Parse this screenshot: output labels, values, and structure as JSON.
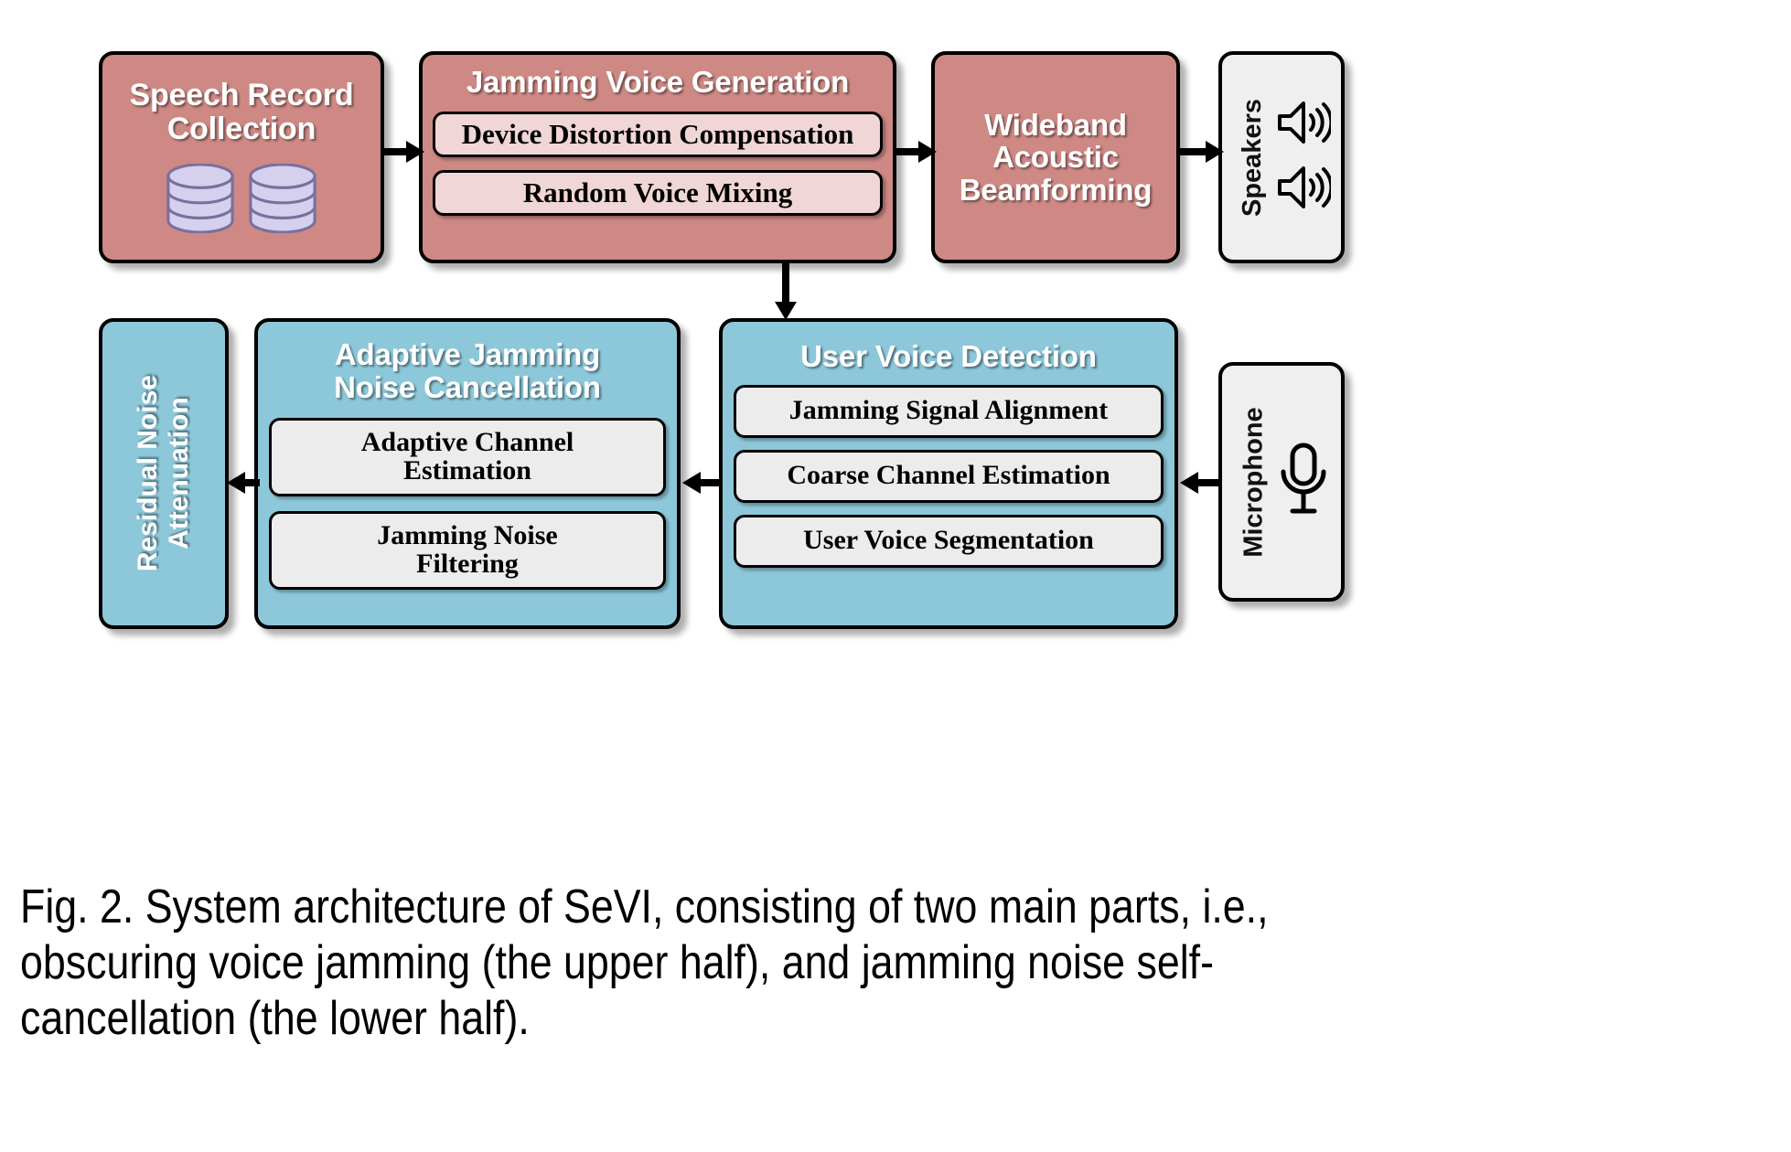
{
  "figure": {
    "caption": "Fig. 2. System architecture of SeVI, consisting of two main parts, i.e., obscuring voice jamming (the upper half), and jamming noise self-cancellation (the lower half).",
    "caption_lines": [
      "Fig. 2. System architecture of SeVI, consisting of two main parts, i.e.,",
      "obscuring voice jamming (the upper half), and jamming noise self-",
      "cancellation (the lower half)."
    ]
  },
  "colors": {
    "rose": "#ce8984",
    "rose_inner": "#f0d6d6",
    "blue": "#8cc8da",
    "blue_inner": "#ececec",
    "grey": "#efefef",
    "outline": "#000000",
    "title_text": "#ffffff",
    "sub_text": "#000000",
    "cylinder_fill": "#d6d0ef",
    "cylinder_stroke": "#7b6f9e"
  },
  "upper_half": {
    "name": "obscuring voice jamming",
    "nodes": {
      "speech_record_collection": {
        "title": "Speech Record\nCollection",
        "title_lines": [
          "Speech Record",
          "Collection"
        ],
        "icon": "database-stack-icon",
        "icon_count": 2
      },
      "jamming_voice_generation": {
        "title": "Jamming Voice Generation",
        "subs": [
          "Device Distortion Compensation",
          "Random Voice Mixing"
        ]
      },
      "wideband_acoustic_beamforming": {
        "title": "Wideband\nAcoustic\nBeamforming",
        "title_lines": [
          "Wideband",
          "Acoustic",
          "Beamforming"
        ]
      },
      "speakers": {
        "label": "Speakers",
        "icon": "speaker-icon",
        "icon_count": 2
      }
    }
  },
  "lower_half": {
    "name": "jamming noise self-cancellation",
    "nodes": {
      "residual_noise_attenuation": {
        "label": "Residual Noise\nAttenuation",
        "label_lines": [
          "Residual Noise",
          "Attenuation"
        ]
      },
      "adaptive_jamming_noise_cancellation": {
        "title": "Adaptive Jamming\nNoise Cancellation",
        "title_lines": [
          "Adaptive Jamming",
          "Noise Cancellation"
        ],
        "subs": [
          "Adaptive Channel\nEstimation",
          "Jamming Noise\nFiltering"
        ],
        "subs_lines": [
          [
            "Adaptive Channel",
            "Estimation"
          ],
          [
            "Jamming Noise",
            "Filtering"
          ]
        ]
      },
      "user_voice_detection": {
        "title": "User Voice Detection",
        "subs": [
          "Jamming Signal Alignment",
          "Coarse Channel Estimation",
          "User Voice Segmentation"
        ]
      },
      "microphone": {
        "label": "Microphone",
        "icon": "microphone-icon"
      }
    }
  },
  "arrows": [
    {
      "id": "speech-to-jvg",
      "from": "speech_record_collection",
      "to": "jamming_voice_generation",
      "direction": "right"
    },
    {
      "id": "jvg-to-wab",
      "from": "jamming_voice_generation",
      "to": "wideband_acoustic_beamforming",
      "direction": "right"
    },
    {
      "id": "wab-to-speakers",
      "from": "wideband_acoustic_beamforming",
      "to": "speakers",
      "direction": "right"
    },
    {
      "id": "jvg-to-uvd",
      "from": "jamming_voice_generation",
      "to": "user_voice_detection",
      "direction": "down"
    },
    {
      "id": "mic-to-uvd",
      "from": "microphone",
      "to": "user_voice_detection",
      "direction": "left"
    },
    {
      "id": "uvd-to-ajnc",
      "from": "user_voice_detection",
      "to": "adaptive_jamming_noise_cancellation",
      "direction": "left"
    },
    {
      "id": "ajnc-to-rna",
      "from": "adaptive_jamming_noise_cancellation",
      "to": "residual_noise_attenuation",
      "direction": "left"
    }
  ]
}
